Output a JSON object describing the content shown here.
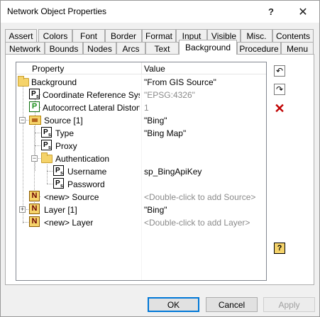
{
  "window": {
    "title": "Network Object Properties",
    "help_glyph": "?",
    "close_glyph": "✕"
  },
  "tabs_row1": [
    "Assert",
    "Colors",
    "Font",
    "Border",
    "Format",
    "Input",
    "Visible",
    "Misc.",
    "Contents"
  ],
  "tabs_row2": [
    "Network",
    "Bounds",
    "Nodes",
    "Arcs",
    "Text",
    "Background",
    "Procedure",
    "Menu"
  ],
  "active_tab": "Background",
  "tree": {
    "col_property": "Property",
    "col_value": "Value",
    "rows": [
      {
        "label": "Background",
        "value": "\"From GIS Source\""
      },
      {
        "label": "Coordinate Reference System",
        "value": "\"EPSG:4326\""
      },
      {
        "label": "Autocorrect Lateral Distortion",
        "value": "1"
      },
      {
        "label": "Source [1]",
        "value": "\"Bing\""
      },
      {
        "label": "Type",
        "value": "\"Bing Map\""
      },
      {
        "label": "Proxy",
        "value": ""
      },
      {
        "label": "Authentication",
        "value": ""
      },
      {
        "label": "Username",
        "value": "sp_BingApiKey"
      },
      {
        "label": "Password",
        "value": ""
      },
      {
        "label": "<new> Source",
        "value": "<Double-click to add Source>"
      },
      {
        "label": "Layer [1]",
        "value": "\"Bing\""
      },
      {
        "label": "<new> Layer",
        "value": "<Double-click to add Layer>"
      }
    ]
  },
  "side": {
    "undo_glyph": "↶",
    "redo_glyph": "↷",
    "delete_glyph": "✕",
    "help_glyph": "?"
  },
  "footer": {
    "ok": "OK",
    "cancel": "Cancel",
    "apply": "Apply"
  }
}
